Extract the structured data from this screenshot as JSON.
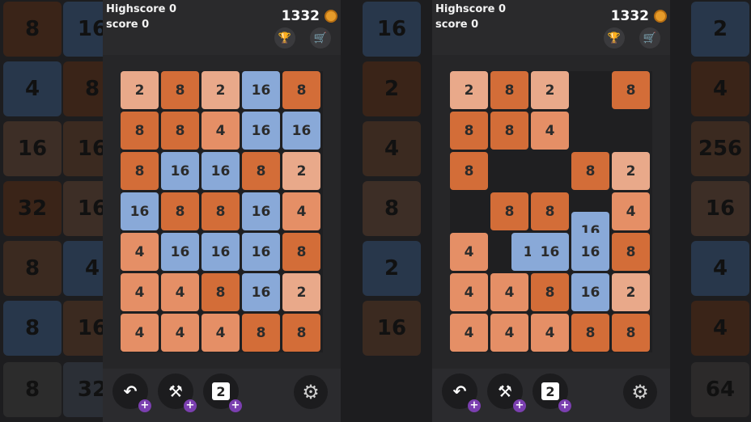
{
  "panels": [
    {
      "highscore": "Highscore 0",
      "score": "score 0",
      "coins": "1332",
      "trophy_icon": "🏆",
      "cart_icon": "🛒",
      "tiles": [
        "2",
        "8",
        "2",
        "16",
        "8",
        "8",
        "8",
        "4",
        "16",
        "16",
        "8",
        "16",
        "16",
        "8",
        "2",
        "16",
        "8",
        "8",
        "16",
        "4",
        "4",
        "16",
        "16",
        "16",
        "8",
        "4",
        "4",
        "8",
        "16",
        "2",
        "4",
        "4",
        "4",
        "8",
        "8"
      ],
      "undo_icon": "↶",
      "hammer_icon": "⚒",
      "swap_count": "2",
      "plus": "+",
      "gear_icon": "⚙"
    },
    {
      "highscore": "Highscore 0",
      "score": "score 0",
      "coins": "1332",
      "trophy_icon": "🏆",
      "cart_icon": "🛒",
      "tiles": [
        "2",
        "8",
        "2",
        "8",
        "8",
        "8",
        "4",
        "8",
        "8",
        "2",
        "8",
        "8",
        "4",
        "16",
        "4",
        "1ı",
        "16",
        "16",
        "8",
        "4",
        "4",
        "8",
        "16",
        "2",
        "4",
        "4",
        "4",
        "8",
        "8"
      ],
      "undo_icon": "↶",
      "hammer_icon": "⚒",
      "swap_count": "2",
      "plus": "+",
      "gear_icon": "⚙"
    }
  ],
  "background_tiles": [
    "8",
    "16",
    "16",
    "2",
    "4",
    "8",
    "2",
    "4",
    "16",
    "16",
    "4",
    "256",
    "32",
    "16",
    "8",
    "16",
    "8",
    "4",
    "2",
    "4",
    "8",
    "16",
    "16",
    "4",
    "8",
    "32",
    "64"
  ],
  "colors": {
    "tile_2": "#e9a98a",
    "tile_4": "#e58f66",
    "tile_8": "#d36d38",
    "tile_16": "#89a9d8",
    "booster_plus": "#7b3fb0",
    "coin": "#e69b2a"
  }
}
